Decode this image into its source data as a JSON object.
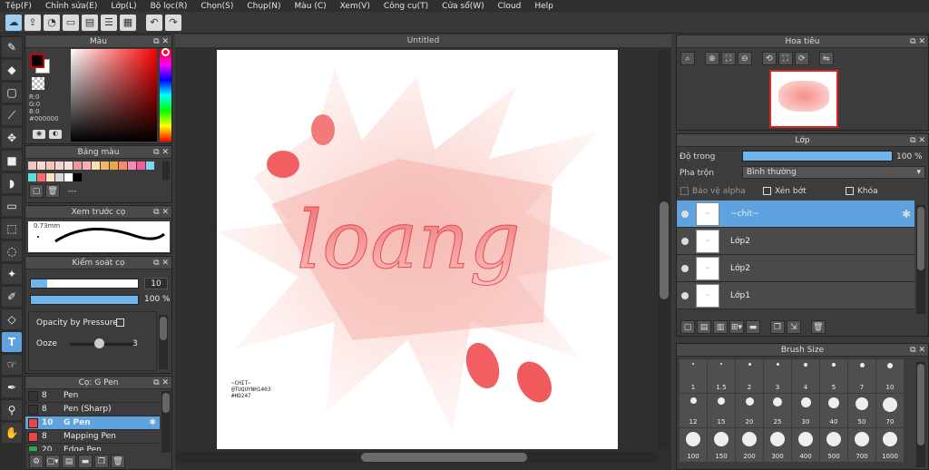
{
  "menu": [
    "Tệp(F)",
    "Chỉnh sửa(E)",
    "Lớp(L)",
    "Bộ lọc(R)",
    "Chọn(S)",
    "Chụp(N)",
    "Màu (C)",
    "Xem(V)",
    "Công cụ(T)",
    "Cửa sổ(W)",
    "Cloud",
    "Help"
  ],
  "toolbar_icons": [
    "cloud-icon",
    "share-icon",
    "chat-icon",
    "comment-icon",
    "document-icon",
    "list-icon",
    "grid-icon",
    "undo-icon",
    "redo-icon"
  ],
  "tools": [
    "brush-icon",
    "eraser-icon",
    "rectangle-icon",
    "line-icon",
    "move-icon",
    "fill-rect-icon",
    "bucket-icon",
    "gradient-icon",
    "select-rect-icon",
    "lasso-icon",
    "magic-wand-icon",
    "select-pen-icon",
    "select-eraser-icon",
    "text-icon",
    "hand-select-icon",
    "eyedropper-icon",
    "pipette-icon",
    "hand-icon"
  ],
  "color_panel": {
    "title": "Màu",
    "r": "R:0",
    "g": "G:0",
    "b": "B:0",
    "hex": "#000000",
    "fg": "#000000",
    "bg": "#ffffff"
  },
  "palette_panel": {
    "title": "Bảng màu",
    "dash": "---",
    "colors": [
      "#f2c5c2",
      "#f7d7cf",
      "#f5c6b9",
      "#f8d3d5",
      "#f5e0dc",
      "#ea9a9a",
      "#f7b0b9",
      "#f8e2b0",
      "#f0b66b",
      "#e8a84a",
      "#f58a6c",
      "#f48cb8",
      "#f25c9c",
      "#80d6f0",
      "#57e0e4",
      "#ff6b6b",
      "#fbe1c4",
      "#d7d7d7",
      "#ffffff",
      "#000000"
    ]
  },
  "brush_preview": {
    "title": "Xem trước cọ",
    "size": "0.73mm"
  },
  "brush_control": {
    "title": "Kiểm soát cọ",
    "size_value": "10",
    "opacity_value": "100 %",
    "size_fill": 0.15,
    "opacity_fill": 1.0,
    "opacity_by_pressure": "Opacity by Pressure",
    "ooze_label": "Ooze",
    "ooze_value": "3",
    "ooze_level": 0.45
  },
  "pen_panel": {
    "title": "Cọ: G Pen",
    "pens": [
      {
        "size": "8",
        "name": "Pen",
        "color": "#333333",
        "selected": false
      },
      {
        "size": "8",
        "name": "Pen (Sharp)",
        "color": "#333333",
        "selected": false
      },
      {
        "size": "10",
        "name": "G Pen",
        "color": "#e8474a",
        "selected": true
      },
      {
        "size": "8",
        "name": "Mapping Pen",
        "color": "#e8474a",
        "selected": false
      },
      {
        "size": "20",
        "name": "Edge Pen",
        "color": "#2ea84a",
        "selected": false
      }
    ]
  },
  "document": {
    "title": "Untitled",
    "artwork_text": "loang",
    "signature_lines": [
      "~CHIT~",
      "@TUQUYNH1403",
      "#HD247"
    ]
  },
  "navigator": {
    "title": "Hoa tiêu"
  },
  "layers_panel": {
    "title": "Lớp",
    "opacity_label": "Độ trong",
    "opacity_value": "100 %",
    "opacity_fill": 1.0,
    "blend_label": "Pha trộn",
    "blend_value": "Bình thường",
    "protect_alpha": "Bảo vệ alpha",
    "clipping": "Xén bớt",
    "lock": "Khóa",
    "layers": [
      {
        "name": "~chit~",
        "selected": true
      },
      {
        "name": "Lớp2",
        "selected": false
      },
      {
        "name": "Lớp2",
        "selected": false
      },
      {
        "name": "Lớp1",
        "selected": false
      }
    ]
  },
  "brush_size_panel": {
    "title": "Brush Size",
    "sizes": [
      "1",
      "1.5",
      "2",
      "3",
      "4",
      "5",
      "7",
      "10",
      "12",
      "15",
      "20",
      "25",
      "30",
      "40",
      "50",
      "70",
      "100",
      "150",
      "200",
      "300",
      "400",
      "500",
      "700",
      "1000"
    ]
  }
}
